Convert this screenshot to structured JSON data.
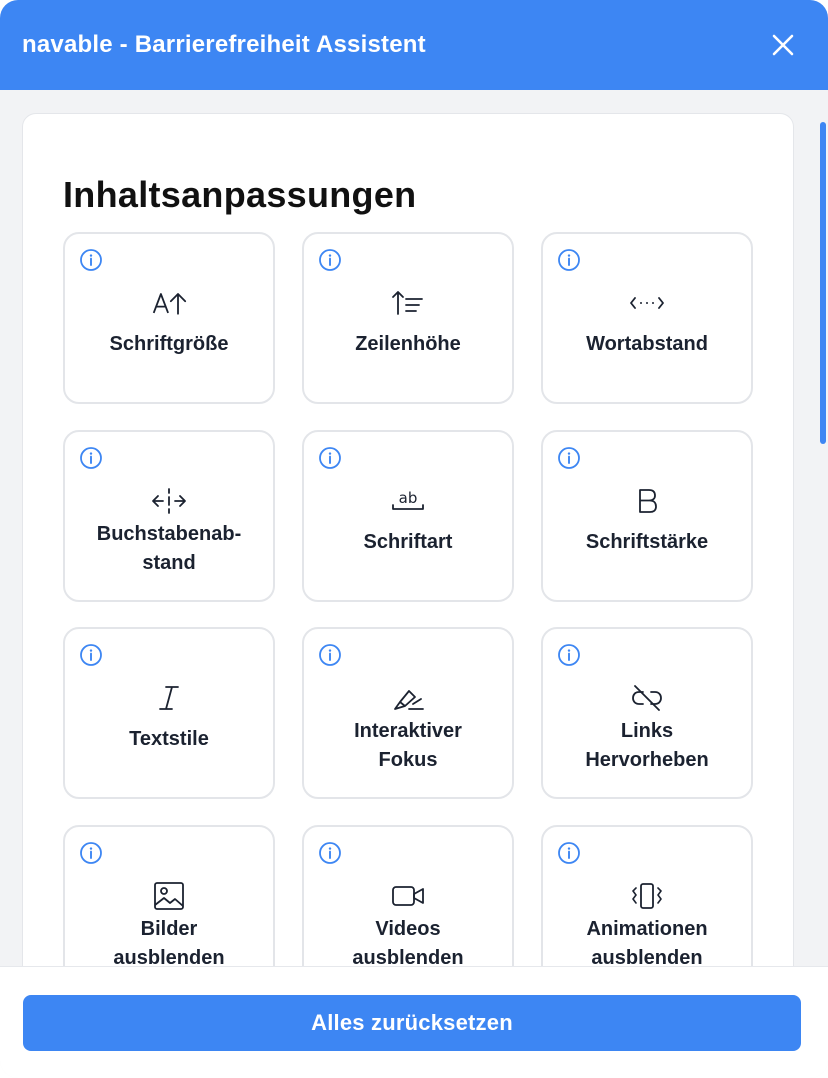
{
  "header": {
    "title": "navable - Barrierefreiheit Assistent",
    "close_icon": "close-icon"
  },
  "section": {
    "title": "Inhaltsanpassungen"
  },
  "tiles": [
    {
      "label": "Schriftgröße",
      "icon": "font-size-icon"
    },
    {
      "label": "Zeilenhöhe",
      "icon": "line-height-icon"
    },
    {
      "label": "Wortabstand",
      "icon": "word-spacing-icon"
    },
    {
      "label": "Buchstabenab-\nstand",
      "icon": "letter-spacing-icon"
    },
    {
      "label": "Schriftart",
      "icon": "font-family-icon"
    },
    {
      "label": "Schriftstärke",
      "icon": "font-weight-icon"
    },
    {
      "label": "Textstile",
      "icon": "text-style-icon"
    },
    {
      "label": "Interaktiver\nFokus",
      "icon": "highlighter-icon"
    },
    {
      "label": "Links\nHervorheben",
      "icon": "link-off-icon"
    },
    {
      "label": "Bilder\nausblenden",
      "icon": "image-icon"
    },
    {
      "label": "Videos\nausblenden",
      "icon": "video-icon"
    },
    {
      "label": "Animationen\nausblenden",
      "icon": "vibrate-icon"
    }
  ],
  "footer": {
    "reset_label": "Alles zurücksetzen"
  },
  "colors": {
    "accent": "#3d86f3",
    "background": "#f2f3f5",
    "tile_border": "#e3e5e9"
  }
}
